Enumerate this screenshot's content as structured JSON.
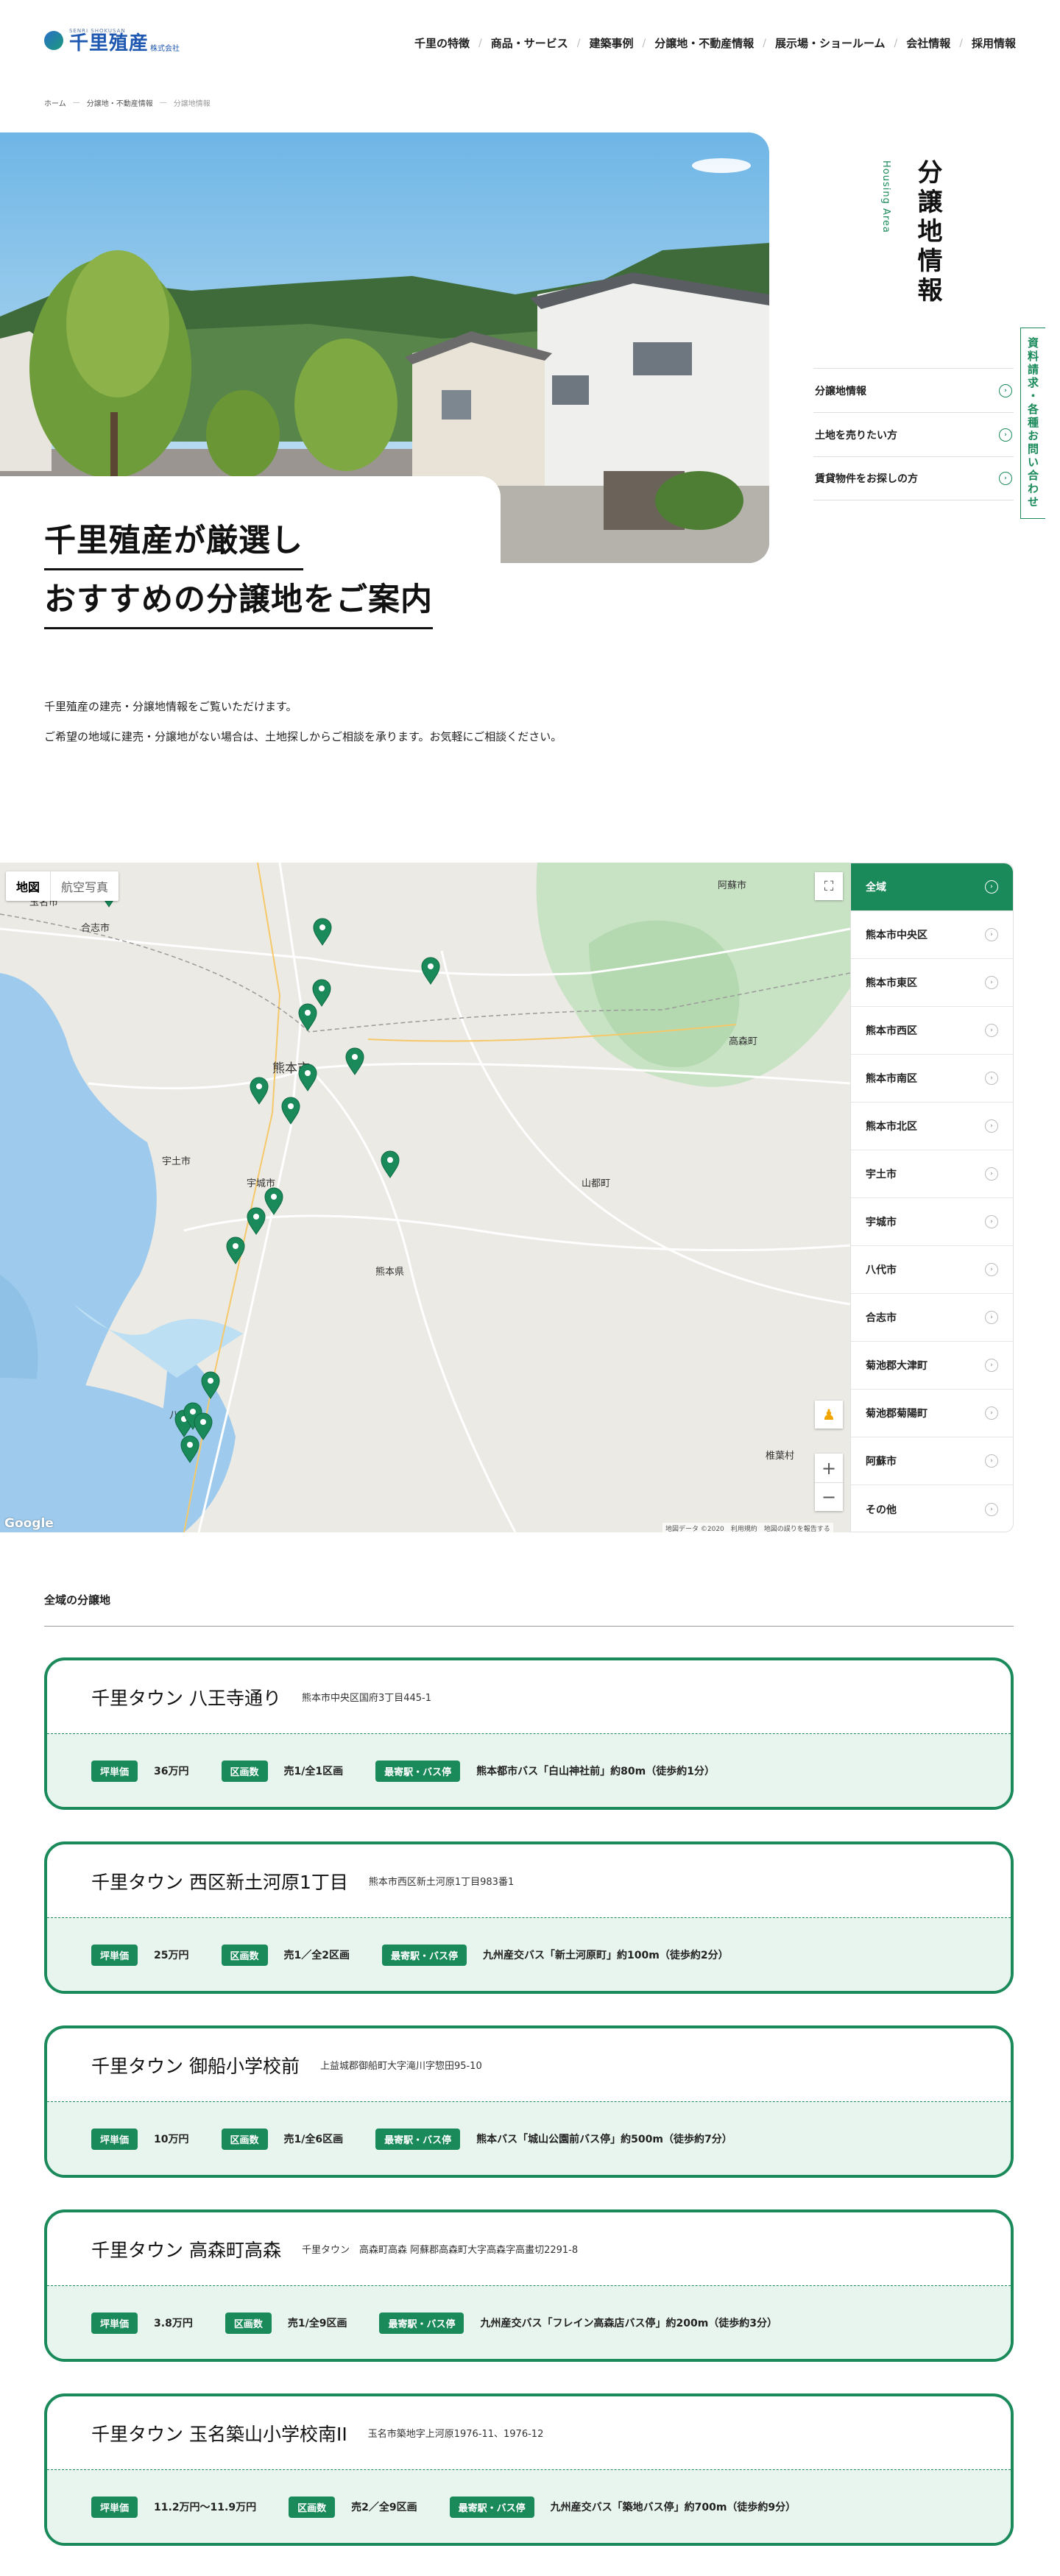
{
  "brand": {
    "name": "千里殖産",
    "sub": "株式会社",
    "tagline": "SENRI SHOKUSAN"
  },
  "nav": [
    "千里の特徴",
    "商品・サービス",
    "建築事例",
    "分譲地・不動産情報",
    "展示場・ショールーム",
    "会社情報",
    "採用情報"
  ],
  "breadcrumb": [
    "ホーム",
    "分譲地・不動産情報",
    "分譲地情報"
  ],
  "hero": {
    "line1": "千里殖産が厳選し",
    "line2": "おすすめの分譲地をご案内"
  },
  "page_title": "分譲地情報",
  "page_title_en": "Housing Area",
  "side_menu": [
    "分譲地情報",
    "土地を売りたい方",
    "賃貸物件をお探しの方"
  ],
  "side_tab": "資料請求・各種お問い合わせ",
  "intro": {
    "line1": "千里殖産の建売・分譲地情報をご覧いただけます。",
    "line2": "ご希望の地域に建売・分譲地がない場合は、土地探しからご相談を承ります。お気軽にご相談ください。"
  },
  "map": {
    "type_map": "地図",
    "type_satellite": "航空写真",
    "credit": "地図データ ©2020　利用規約　地図の誤りを報告する",
    "google": "Google",
    "places": [
      "玉名市",
      "合志市",
      "阿蘇市",
      "熊本市",
      "宇土市",
      "宇城市",
      "熊本県",
      "八代市",
      "山都町",
      "椎葉村",
      "高森町"
    ]
  },
  "areas": [
    "全域",
    "熊本市中央区",
    "熊本市東区",
    "熊本市西区",
    "熊本市南区",
    "熊本市北区",
    "宇土市",
    "宇城市",
    "八代市",
    "合志市",
    "菊池郡大津町",
    "菊池郡菊陽町",
    "阿蘇市",
    "その他"
  ],
  "section_title": "全域の分譲地",
  "labels": {
    "price": "坪単価",
    "lots": "区画数",
    "station": "最寄駅・バス停"
  },
  "listings": [
    {
      "name": "千里タウン 八王寺通り",
      "address": "熊本市中央区国府3丁目445-1",
      "price": "36万円",
      "lots": "売1/全1区画",
      "station": "熊本都市バス「白山神社前」約80m（徒歩約1分）"
    },
    {
      "name": "千里タウン 西区新土河原1丁目",
      "address": "熊本市西区新土河原1丁目983番1",
      "price": "25万円",
      "lots": "売1／全2区画",
      "station": "九州産交バス「新土河原町」約100m（徒歩約2分）"
    },
    {
      "name": "千里タウン 御船小学校前",
      "address": "上益城郡御船町大字滝川字惣田95-10",
      "price": "10万円",
      "lots": "売1/全6区画",
      "station": "熊本バス「城山公園前バス停」約500m（徒歩約7分）"
    },
    {
      "name": "千里タウン 高森町高森",
      "address": "千里タウン　高森町高森 阿蘇郡高森町大字高森字高畫切2291-8",
      "price": "3.8万円",
      "lots": "売1/全9区画",
      "station": "九州産交バス「フレイン高森店バス停」約200m（徒歩約3分）"
    },
    {
      "name": "千里タウン 玉名築山小学校南II",
      "address": "玉名市築地字上河原1976-11、1976-12",
      "price": "11.2万円〜11.9万円",
      "lots": "売2／全9区画",
      "station": "九州産交バス「築地バス停」約700m（徒歩約9分）"
    }
  ],
  "colors": {
    "accent": "#1a8a5a",
    "accent_light": "#e8f4ee",
    "brand_blue": "#1f58b0"
  }
}
